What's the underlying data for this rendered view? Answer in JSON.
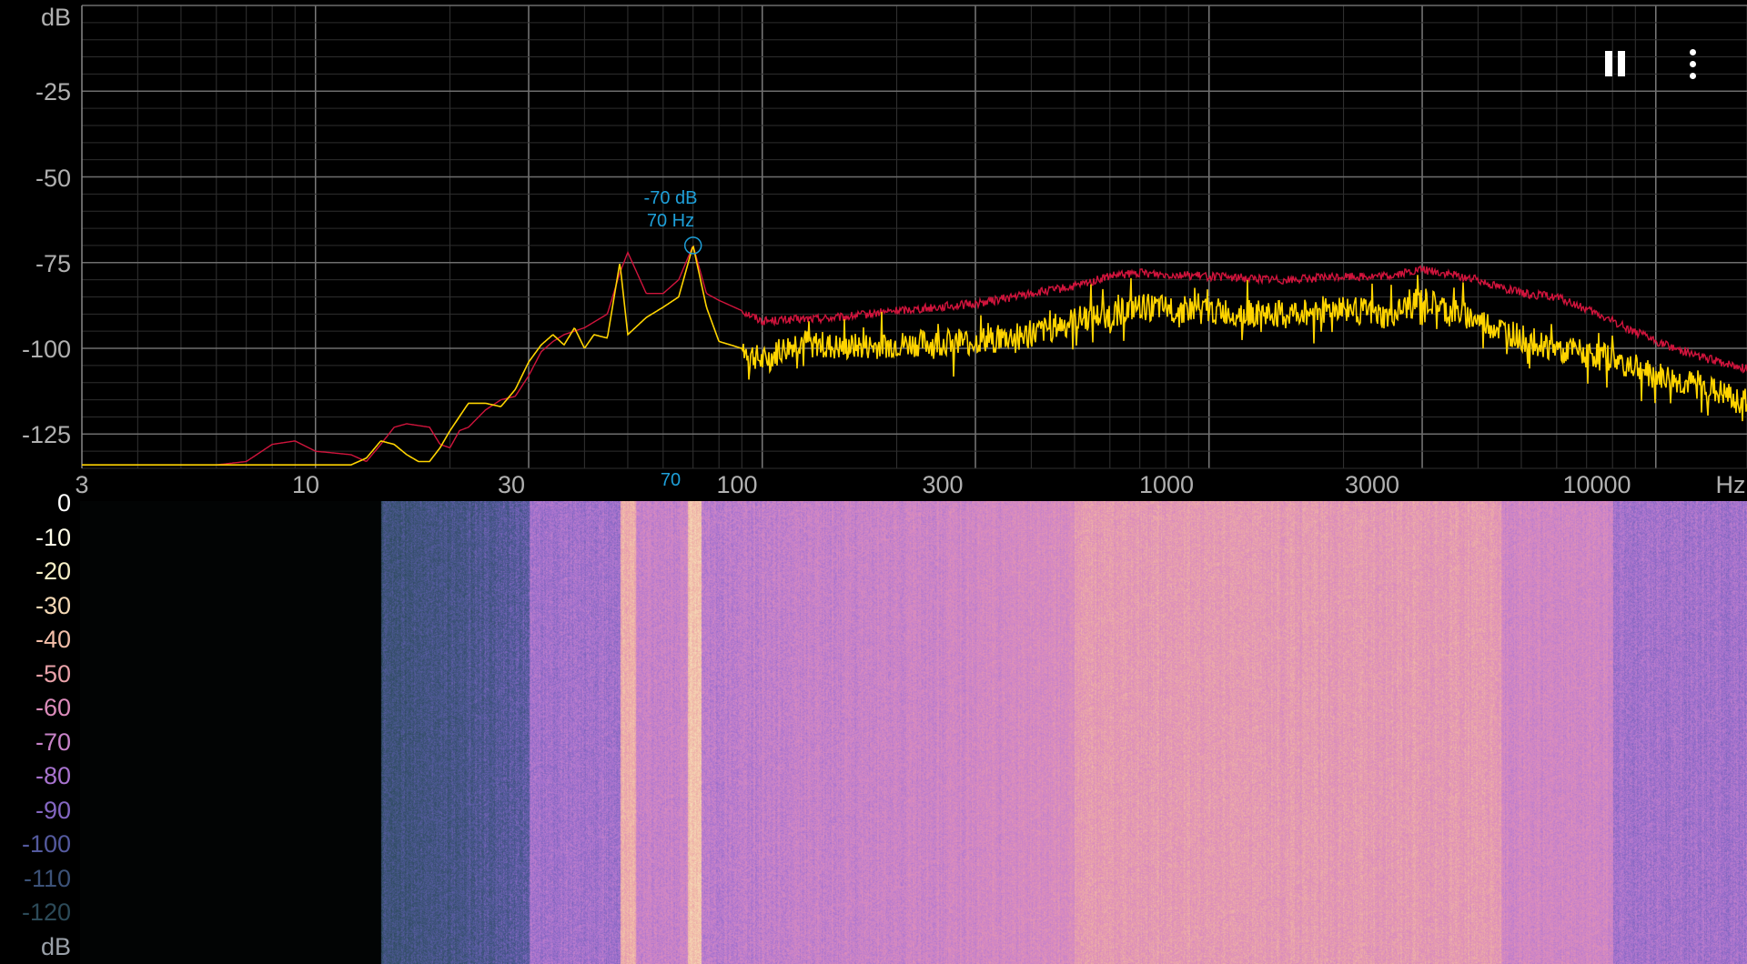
{
  "spectrum": {
    "y_unit": "dB",
    "x_unit": "Hz",
    "y_ticks": [
      "-25",
      "-50",
      "-75",
      "-100",
      "-125"
    ],
    "x_ticks": [
      "3",
      "10",
      "30",
      "100",
      "300",
      "1000",
      "3000",
      "10000"
    ],
    "peak": {
      "db_label": "-70 dB",
      "hz_label": "70 Hz",
      "marker_label": "70"
    },
    "colors": {
      "peak_hold": "#d0143c",
      "current": "#ffd400",
      "marker": "#1e9fd8",
      "grid": "#555555"
    }
  },
  "chart_data": {
    "type": "line",
    "xlabel": "Hz",
    "ylabel": "dB",
    "x_scale": "log",
    "xlim": [
      3,
      16000
    ],
    "ylim": [
      -135,
      0
    ],
    "grid": true,
    "series": [
      {
        "color": "#d0143c",
        "x": [
          3,
          5,
          6,
          7,
          8,
          9,
          10,
          12,
          13,
          14,
          15,
          16,
          18,
          19,
          20,
          21,
          22,
          24,
          26,
          28,
          30,
          32,
          34,
          36,
          40,
          45,
          48,
          50,
          55,
          60,
          65,
          70,
          75,
          80,
          90,
          100,
          150,
          200,
          300,
          400,
          500,
          600,
          700,
          1000,
          1500,
          2000,
          2500,
          3000,
          4000,
          5000,
          6000,
          8000,
          10000,
          13000,
          16000
        ],
        "values": [
          -134,
          -134,
          -134,
          -133,
          -128,
          -127,
          -130,
          -131,
          -133,
          -128,
          -123,
          -122,
          -123,
          -128,
          -129,
          -124,
          -123,
          -118,
          -115,
          -114,
          -108,
          -101,
          -98,
          -96,
          -94,
          -90,
          -78,
          -72,
          -84,
          -84,
          -80,
          -70,
          -84,
          -86,
          -89,
          -92,
          -91,
          -89,
          -87,
          -84,
          -82,
          -79,
          -78,
          -79,
          -80,
          -79,
          -79,
          -77,
          -80,
          -84,
          -85,
          -92,
          -98,
          -103,
          -106
        ]
      },
      {
        "color": "#ffd400",
        "x": [
          3,
          5,
          8,
          10,
          12,
          13,
          14,
          15,
          16,
          17,
          18,
          19,
          20,
          22,
          24,
          26,
          28,
          30,
          32,
          34,
          36,
          38,
          40,
          42,
          45,
          48,
          50,
          55,
          60,
          65,
          70,
          75,
          80,
          90,
          100,
          120,
          150,
          200,
          300,
          400,
          500,
          600,
          700,
          1000,
          1500,
          2000,
          2500,
          3000,
          4000,
          5000,
          6000,
          8000,
          10000,
          13000,
          16000
        ],
        "values": [
          -134,
          -134,
          -134,
          -134,
          -134,
          -132,
          -127,
          -128,
          -131,
          -133,
          -133,
          -129,
          -124,
          -116,
          -116,
          -117,
          -112,
          -104,
          -99,
          -96,
          -99,
          -94,
          -100,
          -96,
          -97,
          -75,
          -96,
          -91,
          -88,
          -85,
          -70,
          -88,
          -98,
          -100,
          -104,
          -98,
          -100,
          -99,
          -98,
          -96,
          -92,
          -90,
          -88,
          -89,
          -90,
          -88,
          -91,
          -86,
          -92,
          -97,
          -100,
          -103,
          -108,
          -112,
          -116
        ]
      }
    ]
  },
  "spectrogram": {
    "unit": "dB",
    "scale": [
      "0",
      "-10",
      "-20",
      "-30",
      "-40",
      "-50",
      "-60",
      "-70",
      "-80",
      "-90",
      "-100",
      "-110",
      "-120"
    ],
    "scale_colors": [
      "#ffffff",
      "#fffde8",
      "#f7f0c6",
      "#f4d8b5",
      "#f2bea8",
      "#e9a2a9",
      "#dc8cbb",
      "#c883c9",
      "#a873cf",
      "#8467c2",
      "#545a9e",
      "#3c5278",
      "#2c4a58"
    ]
  },
  "controls": {
    "pause_icon": "pause-icon",
    "menu_icon": "more-vert-icon"
  }
}
